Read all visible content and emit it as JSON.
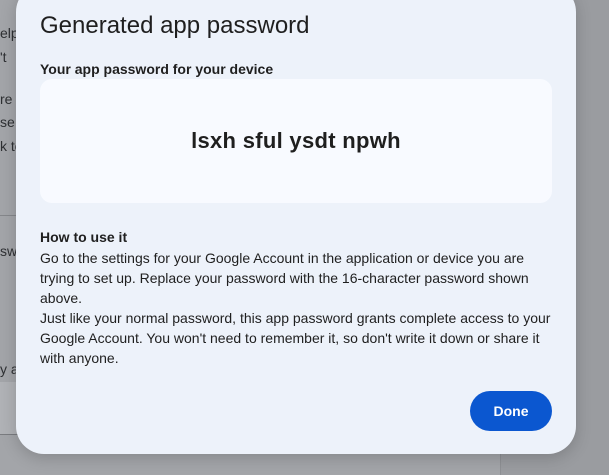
{
  "background": {
    "fragments": [
      "elp",
      "'t",
      "re",
      "se",
      "k to",
      "sw",
      "y ap"
    ]
  },
  "dialog": {
    "title": "Generated app password",
    "password_heading": "Your app password for your device",
    "password_value": "lsxh sful ysdt npwh",
    "howto_heading": "How to use it",
    "howto_paragraph_1": "Go to the settings for your Google Account in the application or device you are trying to set up. Replace your password with the 16-character password shown above.",
    "howto_paragraph_2": "Just like your normal password, this app password grants complete access to your Google Account. You won't need to remember it, so don't write it down or share it with anyone.",
    "done_label": "Done"
  },
  "colors": {
    "dialog_bg": "#edf2fa",
    "password_box_bg": "#f8faff",
    "primary_button": "#0b57d0",
    "scrim": "#9a9ca0"
  }
}
